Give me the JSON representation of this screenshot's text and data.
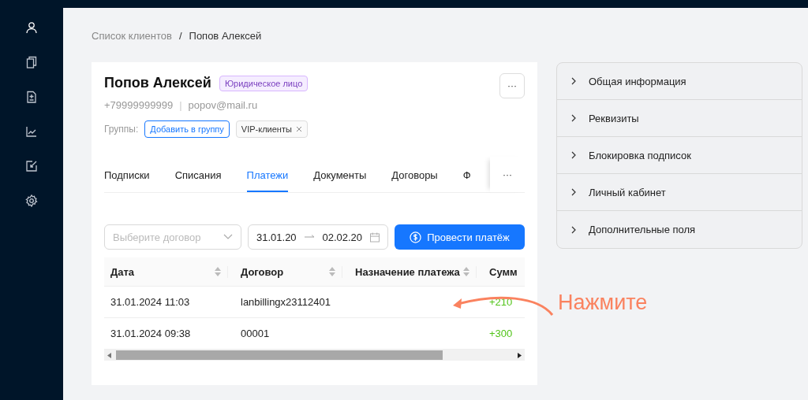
{
  "sidebar": {
    "items": [
      {
        "selected": true
      },
      {
        "selected": false
      },
      {
        "selected": false
      },
      {
        "selected": false
      },
      {
        "selected": false
      },
      {
        "selected": false
      }
    ]
  },
  "breadcrumb": [
    "Список клиентов",
    "Попов Алексей"
  ],
  "breadcrumb_separator": "/",
  "client": {
    "name": "Попов Алексей",
    "badge": "Юридическое лицо",
    "phone": "+79999999999",
    "separator": "|",
    "email": "popov@mail.ru",
    "groups_label": "Группы:",
    "add_group": "Добавить в группу",
    "groups": [
      "VIP-клиенты"
    ]
  },
  "more_button": "···",
  "tabs": [
    {
      "label": "Подписки",
      "selected": false
    },
    {
      "label": "Списания",
      "selected": false
    },
    {
      "label": "Платежи",
      "selected": true
    },
    {
      "label": "Документы",
      "selected": false
    },
    {
      "label": "Договоры",
      "selected": false
    },
    {
      "label": "Ф",
      "selected": false
    }
  ],
  "tabs_more": "···",
  "filters": {
    "contract_placeholder": "Выберите договор",
    "date_from": "31.01.20",
    "date_to": "02.02.20",
    "pay_button": "Провести платёж"
  },
  "table": {
    "columns": [
      "Дата",
      "Договор",
      "Назначение платежа",
      "Сумм"
    ],
    "rows": [
      {
        "date": "31.01.2024 11:03",
        "contract": "lanbillingx23112401",
        "amount": "+210"
      },
      {
        "date": "31.01.2024 09:38",
        "contract": "00001",
        "amount": "+300"
      }
    ]
  },
  "side_panel": {
    "sections": [
      {
        "label": "Общая информация",
        "expanded": false
      },
      {
        "label": "Реквизиты",
        "expanded": false
      },
      {
        "label": "Блокировка подписок",
        "expanded": false
      },
      {
        "label": "Личный кабинет",
        "expanded": false
      },
      {
        "label": "Дополнительные поля",
        "expanded": false
      }
    ]
  },
  "annotation": {
    "text": "Нажмите"
  }
}
